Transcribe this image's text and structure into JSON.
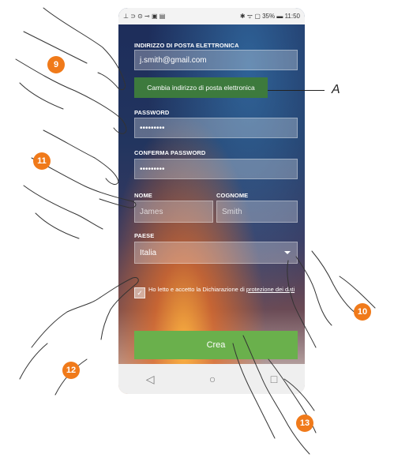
{
  "statusbar": {
    "left_icons": "⊥ ⊃ ⊙ ⊸ ▣ ▤",
    "right_text": "✱ ᯤ ▢ 35% ▬ 11:50"
  },
  "form": {
    "email_label": "INDIRIZZO DI POSTA ELETTRONICA",
    "email_value": "j.smith@gmail.com",
    "change_email_button": "Cambia indirizzo di posta elettronica",
    "password_label": "PASSWORD",
    "password_value": "•••••••••",
    "confirm_password_label": "CONFERMA PASSWORD",
    "confirm_password_value": "•••••••••",
    "name_label": "NOME",
    "name_placeholder": "James",
    "surname_label": "COGNOME",
    "surname_placeholder": "Smith",
    "country_label": "PAESE",
    "country_value": "Italia",
    "consent_text": "Ho letto e accetto la Dichiarazione di",
    "consent_link": "protezione dei dati",
    "checkbox_mark": "✓",
    "create_button": "Crea"
  },
  "navbar": {
    "back_icon": "◁",
    "home_icon": "○",
    "recent_icon": "□"
  },
  "annotations": {
    "callout_a": "A",
    "step_9": "9",
    "step_10": "10",
    "step_11": "11",
    "step_12": "12",
    "step_13": "13",
    "badge_color": "#f07a1a"
  }
}
